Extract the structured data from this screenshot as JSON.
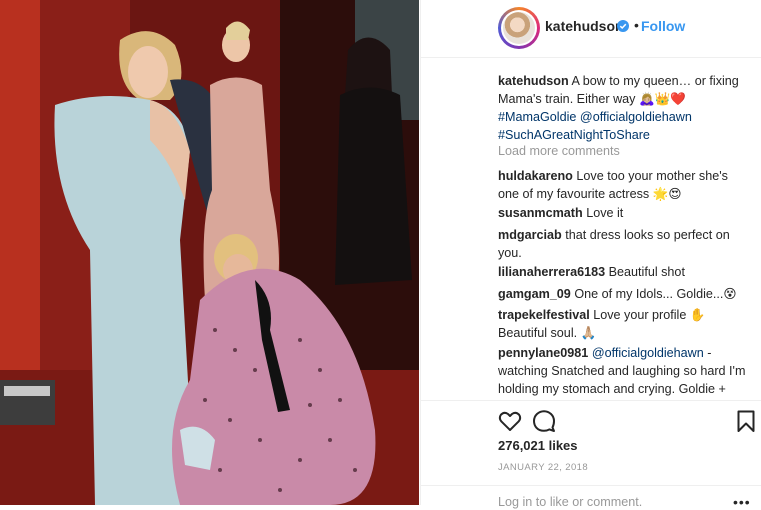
{
  "header": {
    "username": "katehudson",
    "follow_label": "Follow",
    "separator": "•"
  },
  "caption": {
    "username": "katehudson",
    "text": "A bow to my queen… or fixing Mama's train. Either way 🙇🏼‍♀️👑❤️",
    "hashtag1": "#MamaGoldie",
    "mention": "@officialgoldiehawn",
    "hashtag2": "#SuchAGreatNightToShare"
  },
  "load_more": "Load more comments",
  "comments": [
    {
      "user": "huldakareno",
      "text": "Love too your mother she's one of my favourite actress 🌟😍"
    },
    {
      "user": "susanmcmath",
      "text": "Love it"
    },
    {
      "user": "mdgarciab",
      "text": "that dress looks so perfect on you."
    },
    {
      "user": "lilianaherrera6183",
      "text": "Beautiful shot"
    },
    {
      "user": "gamgam_09",
      "text": "One of my Idols... Goldie...😵"
    },
    {
      "user": "trapekelfestival",
      "text": "Love your profile ✋ Beautiful soul. 🙏🏼"
    },
    {
      "user": "pennylane0981",
      "mention": "@officialgoldiehawn",
      "text": "- watching Snatched and laughing so hard I'm holding my stomach and crying. Goldie + Kate = 😍"
    }
  ],
  "likes": "276,021 likes",
  "date": "JANUARY 22, 2018",
  "login_prompt": "Log in to like or comment.",
  "more_label": "•••",
  "icons": {
    "verified": "verified-badge-icon",
    "like": "heart-icon",
    "comment": "comment-bubble-icon",
    "save": "bookmark-icon",
    "more": "more-options-icon"
  },
  "colors": {
    "accent_blue": "#3897f0",
    "link_dark_blue": "#003569",
    "muted_gray": "#999999",
    "text": "#262626"
  }
}
